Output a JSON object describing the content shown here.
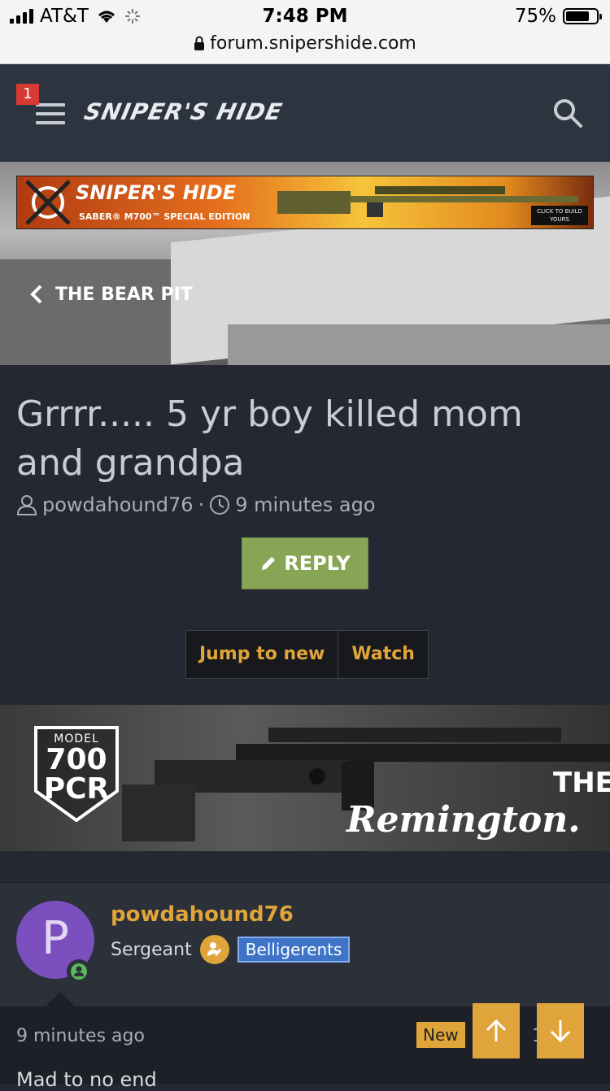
{
  "statusbar": {
    "carrier": "AT&T",
    "time": "7:48 PM",
    "battery": "75%"
  },
  "browser": {
    "url": "forum.snipershide.com"
  },
  "header": {
    "notification_count": "1",
    "logo": "SNIPER'S HIDE",
    "icons": [
      "menu-icon",
      "search-icon"
    ]
  },
  "hero_banner": {
    "title": "SNIPER'S HIDE",
    "subtitle": "SABER® M700™ SPECIAL EDITION",
    "cta": "CLICK TO BUILD YOURS"
  },
  "breadcrumb": {
    "label": "THE BEAR PIT"
  },
  "thread": {
    "title": "Grrrr..... 5 yr boy killed mom and grandpa",
    "author": "powdahound76",
    "separator": "·",
    "posted": "9 minutes ago",
    "reply_label": "REPLY",
    "jump_label": "Jump to new",
    "watch_label": "Watch"
  },
  "ad": {
    "model_label": "MODEL",
    "model_number": "700",
    "model_suffix": "PCR",
    "tagline": "THE",
    "brand": "Remington."
  },
  "post": {
    "avatar_letter": "P",
    "username": "powdahound76",
    "rank": "Sergeant",
    "group": "Belligerents",
    "time": "9 minutes ago",
    "new_label": "New",
    "count": "1",
    "body": "Mad to no end"
  },
  "colors": {
    "accent": "#e0a53a",
    "reply_green": "#88a556",
    "header_bg": "#2c3440",
    "page_bg": "#232833",
    "group_blue": "#3d74c8"
  }
}
